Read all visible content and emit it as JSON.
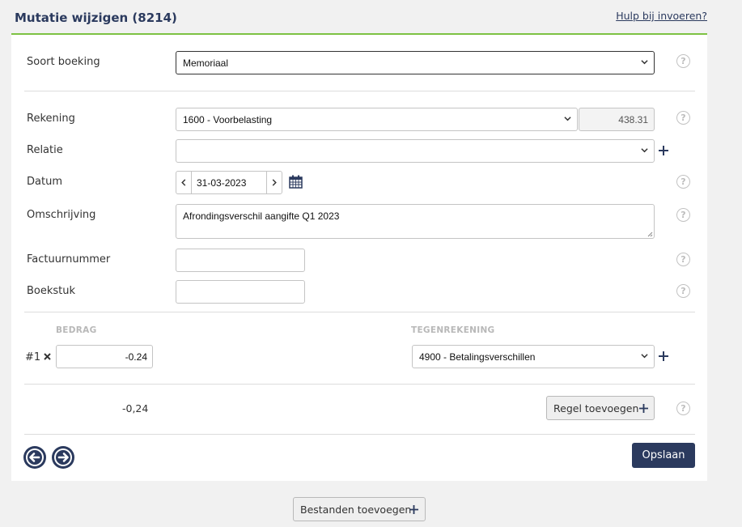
{
  "header": {
    "title": "Mutatie wijzigen (8214)",
    "help_link": "Hulp bij invoeren?"
  },
  "form": {
    "soort_boeking": {
      "label": "Soort boeking",
      "value": "Memoriaal"
    },
    "rekening": {
      "label": "Rekening",
      "value": "1600 - Voorbelasting",
      "balance": "438.31"
    },
    "relatie": {
      "label": "Relatie",
      "value": ""
    },
    "datum": {
      "label": "Datum",
      "value": "31-03-2023"
    },
    "omschrijving": {
      "label": "Omschrijving",
      "value": "Afrondingsverschil aangifte Q1 2023"
    },
    "factuurnummer": {
      "label": "Factuurnummer",
      "value": ""
    },
    "boekstuk": {
      "label": "Boekstuk",
      "value": ""
    }
  },
  "lines": {
    "col_bedrag": "BEDRAG",
    "col_tegenrekening": "TEGENREKENING",
    "rows": [
      {
        "num": "#1",
        "amount": "-0.24",
        "account": "4900 - Betalingsverschillen"
      }
    ],
    "total": "-0,24",
    "add_row_label": "Regel toevoegen"
  },
  "actions": {
    "save_label": "Opslaan",
    "add_files_label": "Bestanden toevoegen"
  },
  "colors": {
    "primary": "#2b3a5e",
    "accent_green": "#7dc243",
    "help_icon": "#c2c2c2"
  }
}
